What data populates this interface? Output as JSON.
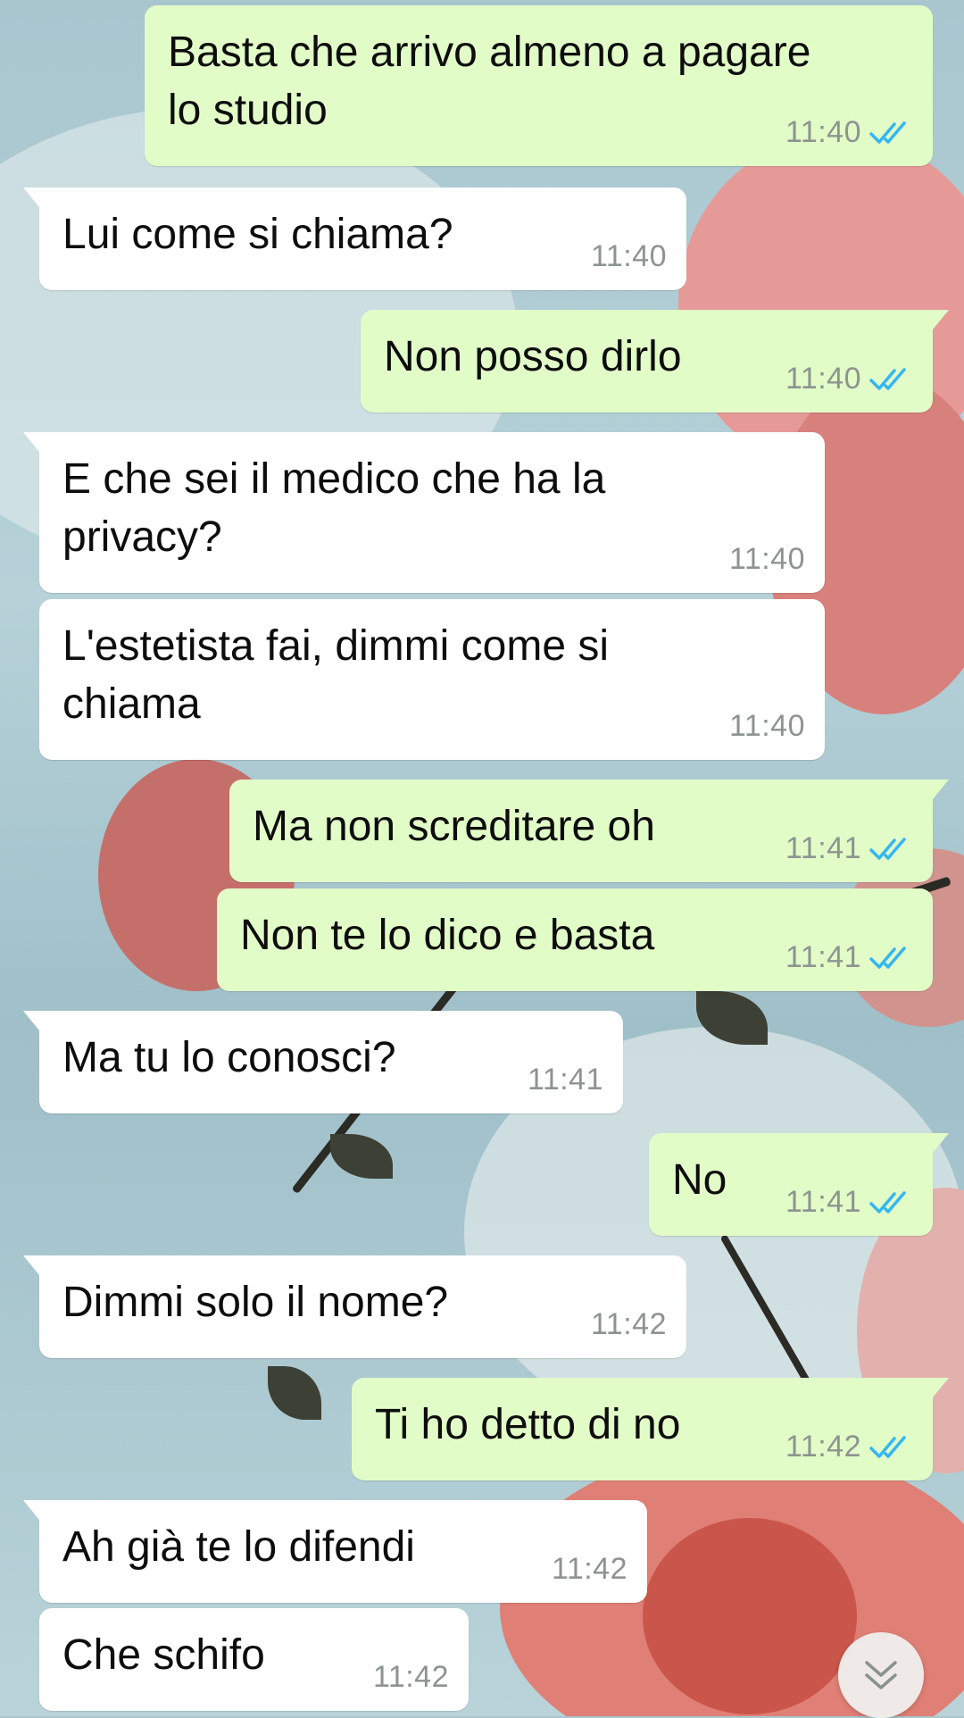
{
  "messages": [
    {
      "direction": "out",
      "text": "Basta che arrivo almeno a pagare\nlo studio",
      "time": "11:40",
      "status": "read"
    },
    {
      "direction": "in",
      "text": "Lui come si chiama?",
      "time": "11:40"
    },
    {
      "direction": "out",
      "text": "Non posso dirlo",
      "time": "11:40",
      "status": "read"
    },
    {
      "direction": "in",
      "text": "E che sei il medico che ha la\nprivacy?",
      "time": "11:40"
    },
    {
      "direction": "in",
      "text": "L'estetista fai, dimmi come si\nchiama",
      "time": "11:40"
    },
    {
      "direction": "out",
      "text": "Ma non screditare oh",
      "time": "11:41",
      "status": "read"
    },
    {
      "direction": "out",
      "text": "Non te lo dico e basta",
      "time": "11:41",
      "status": "read"
    },
    {
      "direction": "in",
      "text": "Ma tu lo conosci?",
      "time": "11:41"
    },
    {
      "direction": "out",
      "text": "No",
      "time": "11:41",
      "status": "read"
    },
    {
      "direction": "in",
      "text": "Dimmi solo il nome?",
      "time": "11:42"
    },
    {
      "direction": "out",
      "text": "Ti ho detto di no",
      "time": "11:42",
      "status": "read"
    },
    {
      "direction": "in",
      "text": "Ah già te lo difendi",
      "time": "11:42"
    },
    {
      "direction": "in",
      "text": "Che schifo",
      "time": "11:42"
    }
  ],
  "colors": {
    "incoming_bubble": "#ffffff",
    "outgoing_bubble": "#e2fcc8",
    "read_ticks": "#34b7f1",
    "timestamp": "#8d9490"
  },
  "icons": {
    "read_receipt": "double-check-icon",
    "scroll_down": "chevron-double-down-icon"
  }
}
